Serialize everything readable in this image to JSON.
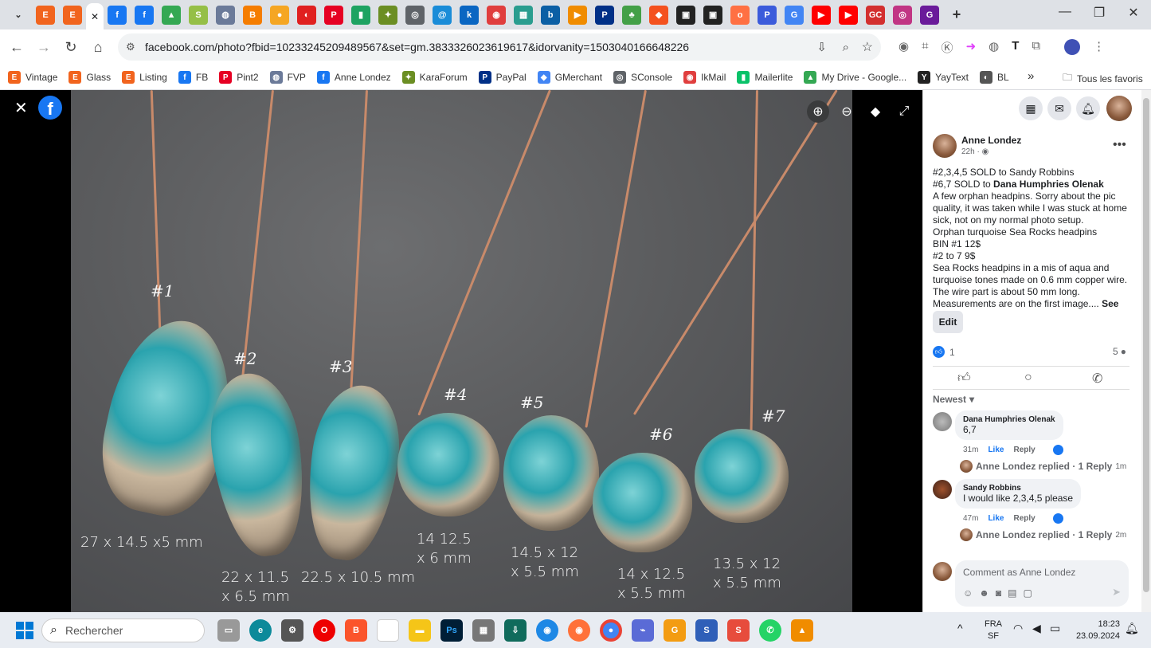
{
  "browser": {
    "tab_icons": [
      {
        "name": "tab-down-icon",
        "color": "#dee1e6",
        "glyph": "⌄"
      },
      {
        "name": "etsy-icon",
        "color": "#f1641e",
        "glyph": "E"
      },
      {
        "name": "etsy-icon",
        "color": "#f1641e",
        "glyph": "E"
      },
      {
        "name": "facebook-icon",
        "color": "#1877f2",
        "glyph": "f"
      },
      {
        "name": "facebook-icon",
        "color": "#1877f2",
        "glyph": "f"
      },
      {
        "name": "drive-icon",
        "color": "#34a853",
        "glyph": "▲"
      },
      {
        "name": "shopify-icon",
        "color": "#95bf47",
        "glyph": "S"
      },
      {
        "name": "fvp-icon",
        "color": "#6b7a99",
        "glyph": "◍"
      },
      {
        "name": "blogger-icon",
        "color": "#f57d00",
        "glyph": "B"
      },
      {
        "name": "circle-icon",
        "color": "#f5a623",
        "glyph": "●"
      },
      {
        "name": "red-icon",
        "color": "#e02020",
        "glyph": "◐"
      },
      {
        "name": "pinterest-icon",
        "color": "#e60023",
        "glyph": "P"
      },
      {
        "name": "chat-icon",
        "color": "#1ea362",
        "glyph": "▮"
      },
      {
        "name": "turtle-icon",
        "color": "#6b8e23",
        "glyph": "✦"
      },
      {
        "name": "console-icon",
        "color": "#5f6368",
        "glyph": "◎"
      },
      {
        "name": "at-icon",
        "color": "#1a8cd8",
        "glyph": "@"
      },
      {
        "name": "k-icon",
        "color": "#0a66c2",
        "glyph": "k"
      },
      {
        "name": "mail-icon",
        "color": "#e03e3e",
        "glyph": "◉"
      },
      {
        "name": "grid-icon",
        "color": "#2a9d8f",
        "glyph": "▦"
      },
      {
        "name": "box-icon",
        "color": "#0b5fa5",
        "glyph": "b"
      },
      {
        "name": "play-icon",
        "color": "#f08c00",
        "glyph": "▶"
      },
      {
        "name": "paypal-icon",
        "color": "#003087",
        "glyph": "P"
      },
      {
        "name": "green-icon",
        "color": "#43a047",
        "glyph": "♣"
      },
      {
        "name": "orange-icon",
        "color": "#f4511e",
        "glyph": "◆"
      },
      {
        "name": "dark-icon",
        "color": "#222222",
        "glyph": "▣"
      },
      {
        "name": "dark-icon",
        "color": "#222222",
        "glyph": "▣"
      },
      {
        "name": "o-icon",
        "color": "#ff7043",
        "glyph": "o"
      },
      {
        "name": "p-icon",
        "color": "#3b5bdb",
        "glyph": "P"
      },
      {
        "name": "google-icon",
        "color": "#4285f4",
        "glyph": "G"
      },
      {
        "name": "youtube-icon",
        "color": "#ff0000",
        "glyph": "▶"
      },
      {
        "name": "youtube-icon",
        "color": "#ff0000",
        "glyph": "▶"
      },
      {
        "name": "gc-icon",
        "color": "#d32f2f",
        "glyph": "GC"
      },
      {
        "name": "instagram-icon",
        "color": "#c13584",
        "glyph": "◎"
      },
      {
        "name": "g-icon",
        "color": "#6a1b9a",
        "glyph": "G"
      }
    ],
    "new_tab": "+",
    "window_controls": [
      "—",
      "❐",
      "✕"
    ],
    "url": "facebook.com/photo?fbid=10233245209489567&set=gm.3833326023619617&idorvanity=1503040166648226",
    "bookmarks": [
      {
        "label": "Vintage",
        "color": "#f1641e",
        "glyph": "E"
      },
      {
        "label": "Glass",
        "color": "#f1641e",
        "glyph": "E"
      },
      {
        "label": "Listing",
        "color": "#f1641e",
        "glyph": "E"
      },
      {
        "label": "FB",
        "color": "#1877f2",
        "glyph": "f"
      },
      {
        "label": "Pint2",
        "color": "#e60023",
        "glyph": "P"
      },
      {
        "label": "FVP",
        "color": "#6b7a99",
        "glyph": "◍"
      },
      {
        "label": "Anne Londez",
        "color": "#1877f2",
        "glyph": "f"
      },
      {
        "label": "KaraForum",
        "color": "#6b8e23",
        "glyph": "✦"
      },
      {
        "label": "PayPal",
        "color": "#003087",
        "glyph": "P"
      },
      {
        "label": "GMerchant",
        "color": "#4285f4",
        "glyph": "◆"
      },
      {
        "label": "SConsole",
        "color": "#5f6368",
        "glyph": "◎"
      },
      {
        "label": "IkMail",
        "color": "#e03e3e",
        "glyph": "◉"
      },
      {
        "label": "Mailerlite",
        "color": "#09c269",
        "glyph": "▮"
      },
      {
        "label": "My Drive - Google...",
        "color": "#34a853",
        "glyph": "▲"
      },
      {
        "label": "YayText",
        "color": "#222222",
        "glyph": "Y"
      },
      {
        "label": "BL",
        "color": "#555555",
        "glyph": "◐"
      }
    ],
    "bookmarks_more": "»",
    "all_bookmarks": "Tous les favoris"
  },
  "photo": {
    "labels": [
      {
        "num": "#1",
        "size": "27 x 14.5 x5 mm"
      },
      {
        "num": "#2",
        "size": "22 x 11.5\nx 6.5 mm"
      },
      {
        "num": "#3",
        "size": "22.5 x 10.5 mm"
      },
      {
        "num": "#4",
        "size": "14 12.5\nx 6 mm"
      },
      {
        "num": "#5",
        "size": "14.5 x 12\nx 5.5 mm"
      },
      {
        "num": "#6",
        "size": "14 x 12.5\nx 5.5 mm"
      },
      {
        "num": "#7",
        "size": "13.5 x 12\nx 5.5 mm"
      }
    ]
  },
  "post": {
    "author": "Anne Londez",
    "time": "22h ·",
    "lines_prefix": [
      "#2,3,4,5 SOLD to Sandy Robbins"
    ],
    "sold_line_start": "#6,7 SOLD to ",
    "sold_line_name": "Dana Humphries Olenak",
    "body": "A few orphan headpins. Sorry about the pic quality, it was taken while I was stuck at home sick, not on my normal photo setup.\nOrphan turquoise Sea Rocks headpins\nBIN #1 12$\n#2 to 7 9$\nSea Rocks headpins in a mis of aqua and turquoise tones made on 0.6 mm copper wire. The wire part is about 50 mm long. Measurements are on the first image....",
    "see_more": "See more",
    "edit": "Edit",
    "likes": "1",
    "comments_count": "5",
    "sort": "Newest",
    "comments": [
      {
        "name": "Dana Humphries Olenak",
        "text": "6,7",
        "time": "31m",
        "like": "Like",
        "reply": "Reply",
        "replied": "Anne Londez replied · 1 Reply",
        "replied_time": "1m"
      },
      {
        "name": "Sandy Robbins",
        "text": "I would like 2,3,4,5 please",
        "time": "47m",
        "like": "Like",
        "reply": "Reply",
        "replied": "Anne Londez replied · 1 Reply",
        "replied_time": "2m"
      }
    ],
    "comment_placeholder": "Comment as Anne Londez"
  },
  "taskbar": {
    "search": "Rechercher",
    "lang1": "FRA",
    "lang2": "SF",
    "time": "18:23",
    "date": "23.09.2024"
  }
}
